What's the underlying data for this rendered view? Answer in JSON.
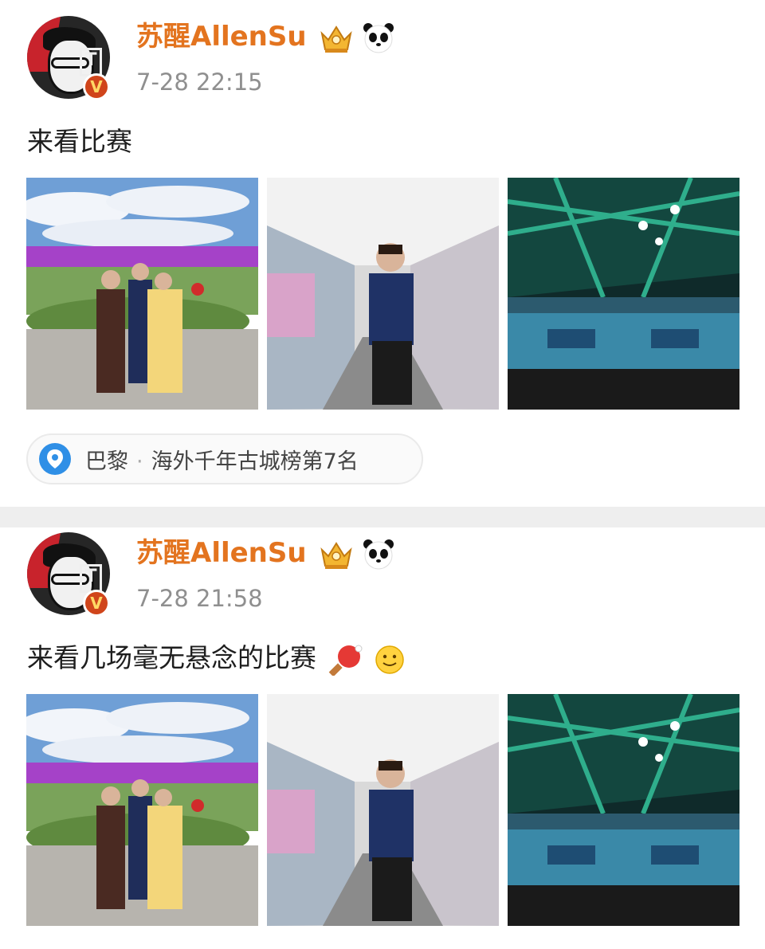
{
  "posts": [
    {
      "username": "苏醒AllenSu",
      "timestamp": "7-28 22:15",
      "text": "来看比赛",
      "emojis": [],
      "photos": [
        "group-photo-outdoor",
        "walkway-portrait",
        "table-tennis-arena"
      ],
      "location": {
        "city": "巴黎",
        "separator": "·",
        "tag": "海外千年古城榜第7名"
      }
    },
    {
      "username": "苏醒AllenSu",
      "timestamp": "7-28 21:58",
      "text": "来看几场毫无悬念的比赛",
      "emojis": [
        "ping-pong-icon",
        "smile-icon"
      ],
      "photos": [
        "group-photo-outdoor",
        "walkway-portrait",
        "table-tennis-arena"
      ]
    }
  ],
  "colors": {
    "username": "#e3741f",
    "timestamp": "#8f8f8f",
    "location_pin": "#2f8fe6",
    "divider": "#eeeeee",
    "verified": "#d0451b"
  }
}
